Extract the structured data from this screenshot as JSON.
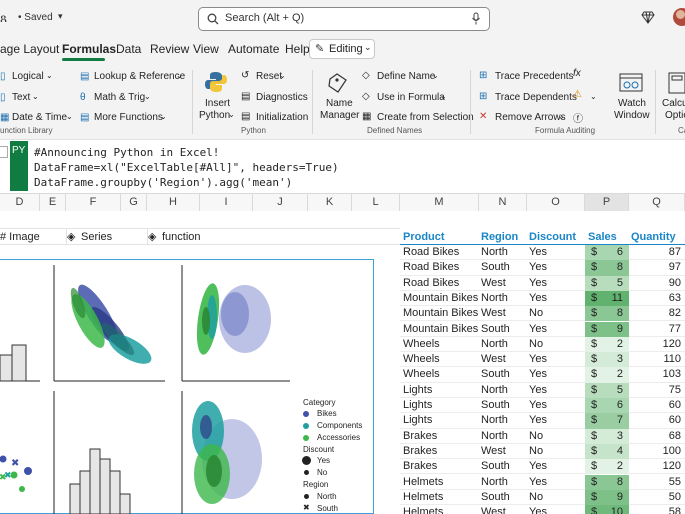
{
  "titlebar": {
    "saved": "• Saved",
    "search_placeholder": "Search (Alt + Q)"
  },
  "menu": {
    "tabs": [
      "age Layout",
      "Formulas",
      "Data",
      "Review",
      "View",
      "Automate",
      "Help"
    ],
    "active": "Formulas",
    "editing": "Editing"
  },
  "ribbon": {
    "function_library": {
      "items": [
        "Logical",
        "Text",
        "Date & Time",
        "Lookup & Reference",
        "Math & Trig",
        "More Functions"
      ],
      "label": "unction Library"
    },
    "python": {
      "insert": "Insert",
      "insert2": "Python",
      "reset": "Reset",
      "diagnostics": "Diagnostics",
      "initialization": "Initialization",
      "label": "Python"
    },
    "defined_names": {
      "name_manager": "Name",
      "name_manager2": "Manager",
      "define_name": "Define Name",
      "use_in_formula": "Use in Formula",
      "create": "Create from Selection",
      "label": "Defined Names"
    },
    "auditing": {
      "trace_precedents": "Trace Precedents",
      "trace_dependents": "Trace Dependents",
      "remove_arrows": "Remove Arrows",
      "label": "Formula Auditing"
    },
    "watch": {
      "watch": "Watch",
      "window": "Window"
    },
    "calc": {
      "calc": "Calcul",
      "opti": "Optio",
      "label": "Ca"
    }
  },
  "formula": {
    "badge": "PY",
    "lines": [
      "#Announcing Python in Excel!",
      "DataFrame=xl(\"ExcelTable[#All]\", headers=True)",
      "DataFrame.groupby('Region').agg('mean')"
    ]
  },
  "columns": [
    "D",
    "E",
    "F",
    "G",
    "H",
    "I",
    "J",
    "K",
    "L",
    "M",
    "N",
    "O",
    "P",
    "Q"
  ],
  "image_headers": {
    "image": "# Image",
    "series": "Series",
    "function": "function"
  },
  "legend": {
    "category_title": "Category",
    "categories": [
      "Bikes",
      "Components",
      "Accessories"
    ],
    "discount_title": "Discount",
    "discount": [
      "Yes",
      "No"
    ],
    "region_title": "Region",
    "regions": [
      "North",
      "South"
    ]
  },
  "table": {
    "headers": [
      "Product",
      "Region",
      "Discount",
      "Sales",
      "Quantity"
    ],
    "rows": [
      [
        "Road Bikes",
        "North",
        "Yes",
        "6",
        "87"
      ],
      [
        "Road Bikes",
        "South",
        "Yes",
        "8",
        "97"
      ],
      [
        "Road Bikes",
        "West",
        "Yes",
        "5",
        "90"
      ],
      [
        "Mountain Bikes",
        "North",
        "Yes",
        "11",
        "63"
      ],
      [
        "Mountain Bikes",
        "West",
        "No",
        "8",
        "82"
      ],
      [
        "Mountain Bikes",
        "South",
        "Yes",
        "9",
        "77"
      ],
      [
        "Wheels",
        "North",
        "No",
        "2",
        "120"
      ],
      [
        "Wheels",
        "West",
        "Yes",
        "3",
        "110"
      ],
      [
        "Wheels",
        "South",
        "Yes",
        "2",
        "103"
      ],
      [
        "Lights",
        "North",
        "Yes",
        "5",
        "75"
      ],
      [
        "Lights",
        "South",
        "Yes",
        "6",
        "60"
      ],
      [
        "Lights",
        "North",
        "Yes",
        "7",
        "60"
      ],
      [
        "Brakes",
        "North",
        "No",
        "3",
        "68"
      ],
      [
        "Brakes",
        "West",
        "No",
        "4",
        "100"
      ],
      [
        "Brakes",
        "South",
        "Yes",
        "2",
        "120"
      ],
      [
        "Helmets",
        "North",
        "Yes",
        "8",
        "55"
      ],
      [
        "Helmets",
        "South",
        "No",
        "9",
        "50"
      ],
      [
        "Helmets",
        "West",
        "Yes",
        "10",
        "58"
      ]
    ],
    "currency": "$"
  },
  "colors": {
    "accent_green": "#107c41",
    "header_blue": "#1a86c8",
    "bikes": "#3f51a8",
    "components": "#1fa0a0",
    "accessories": "#3cb84a"
  }
}
